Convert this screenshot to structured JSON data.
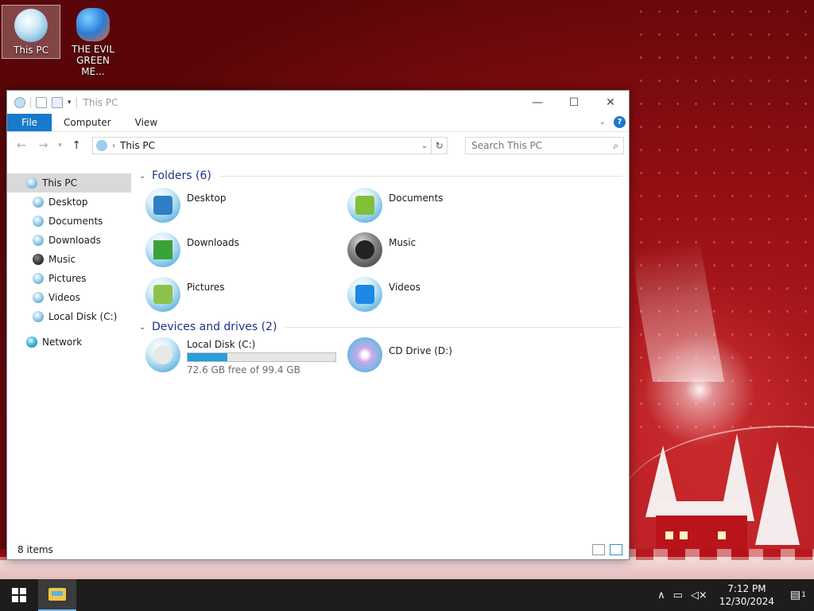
{
  "desktop": {
    "icons": [
      {
        "label": "This PC"
      },
      {
        "label": "THE EVIL GREEN ME..."
      }
    ]
  },
  "window": {
    "title": "This PC",
    "ribbon_tabs": [
      "File",
      "Computer",
      "View"
    ],
    "address_path": "This PC",
    "search_placeholder": "Search This PC",
    "nav_items": [
      {
        "label": "This PC"
      },
      {
        "label": "Desktop"
      },
      {
        "label": "Documents"
      },
      {
        "label": "Downloads"
      },
      {
        "label": "Music"
      },
      {
        "label": "Pictures"
      },
      {
        "label": "Videos"
      },
      {
        "label": "Local Disk (C:)"
      },
      {
        "label": "Network"
      }
    ],
    "folders_header": "Folders (6)",
    "folders": [
      {
        "label": "Desktop",
        "icon": "desktop-folder-icon"
      },
      {
        "label": "Documents",
        "icon": "documents-folder-icon"
      },
      {
        "label": "Downloads",
        "icon": "downloads-folder-icon"
      },
      {
        "label": "Music",
        "icon": "music-folder-icon"
      },
      {
        "label": "Pictures",
        "icon": "pictures-folder-icon"
      },
      {
        "label": "Videos",
        "icon": "videos-folder-icon"
      }
    ],
    "drives_header": "Devices and drives (2)",
    "drives": [
      {
        "label": "Local Disk (C:)",
        "free_text": "72.6 GB free of 99.4 GB",
        "used_fraction": 0.27
      },
      {
        "label": "CD Drive (D:)"
      }
    ],
    "status_text": "8 items"
  },
  "taskbar": {
    "time": "7:12 PM",
    "date": "12/30/2024",
    "notification_count": "1"
  },
  "colors": {
    "accent": "#1979ca",
    "drive_bar": "#26a0da",
    "taskbar": "#1d1d1d"
  }
}
